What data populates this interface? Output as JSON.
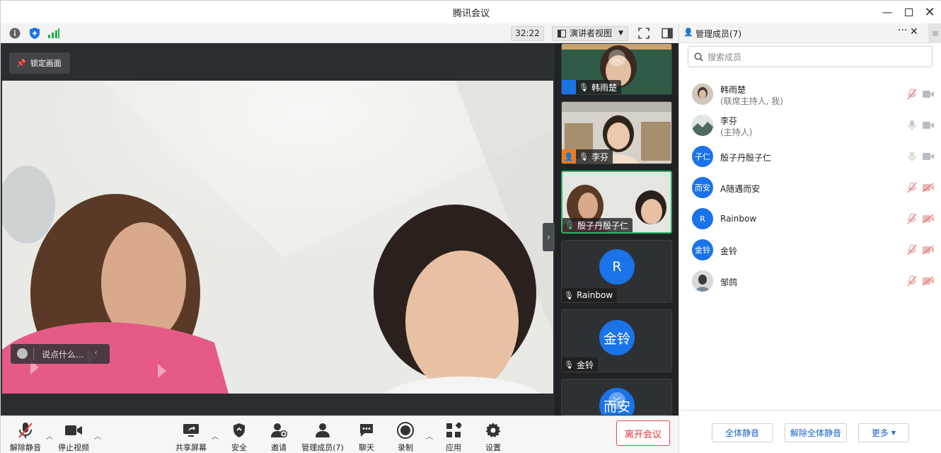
{
  "window": {
    "title": "腾讯会议"
  },
  "toolbar": {
    "timer": "32:22",
    "view_label": "演讲者视图"
  },
  "stage": {
    "lock_label": "锁定画面",
    "chat_placeholder": "说点什么..."
  },
  "thumbnails": [
    {
      "name": "韩雨楚"
    },
    {
      "name": "李芬"
    },
    {
      "name": "殷子丹殷子仁"
    },
    {
      "name": "Rainbow",
      "avatar": "R"
    },
    {
      "name": "金铃",
      "avatar": "金铃"
    },
    {
      "avatar": "而安"
    }
  ],
  "controls": {
    "unmute": "解除静音",
    "stop_video": "停止视频",
    "share": "共享屏幕",
    "security": "安全",
    "invite": "邀请",
    "manage": "管理成员(7)",
    "chat": "聊天",
    "record": "录制",
    "apps": "应用",
    "settings": "设置",
    "leave": "离开会议"
  },
  "panel": {
    "title": "管理成员(7)",
    "search_placeholder": "搜索成员",
    "members": [
      {
        "name": "韩雨楚",
        "role": "(联席主持人, 我)",
        "avatar": ""
      },
      {
        "name": "李芬",
        "role": "(主持人)",
        "avatar": ""
      },
      {
        "name": "殷子丹殷子仁",
        "role": "",
        "avatar": "子仁"
      },
      {
        "name": "A随遇而安",
        "role": "",
        "avatar": "而安"
      },
      {
        "name": "Rainbow",
        "role": "",
        "avatar": "R"
      },
      {
        "name": "金铃",
        "role": "",
        "avatar": "金铃"
      },
      {
        "name": "邹鸽",
        "role": "",
        "avatar": ""
      }
    ],
    "footer": {
      "mute_all": "全体静音",
      "unmute_all": "解除全体静音",
      "more": "更多"
    }
  },
  "colors": {
    "accent": "#1a73e8",
    "active_border": "#2fb36b",
    "leave_red": "#e03434"
  }
}
